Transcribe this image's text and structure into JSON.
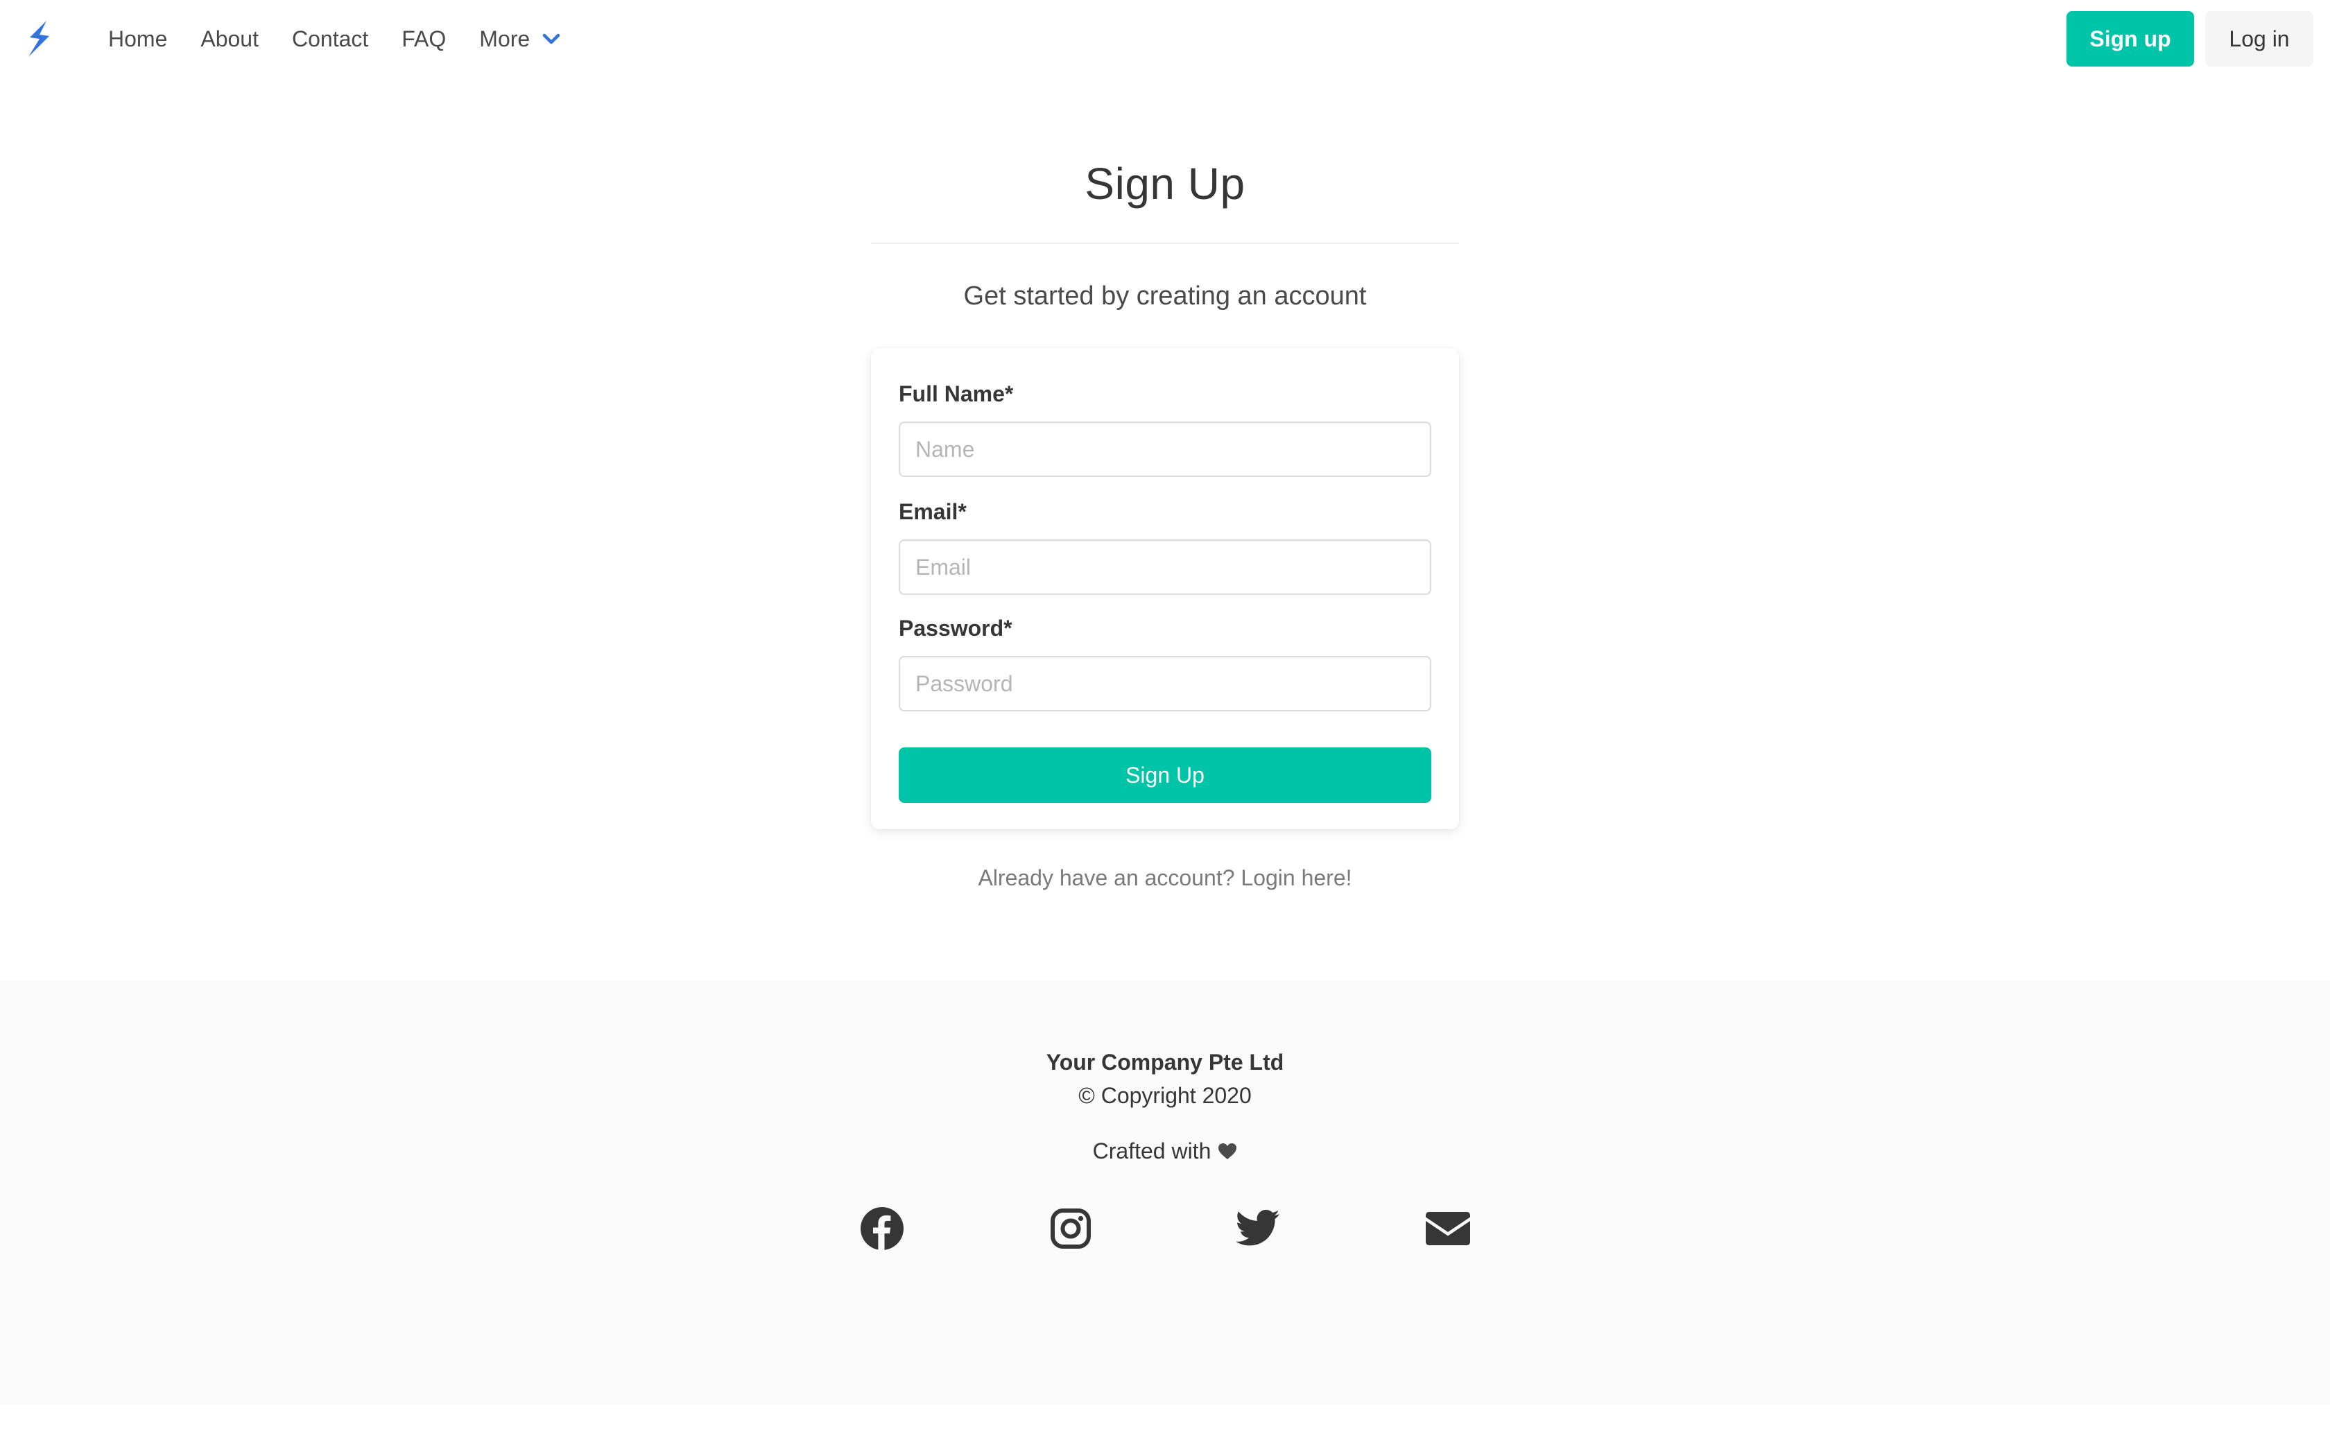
{
  "navbar": {
    "brand_icon": "lightning-bolt-icon",
    "links": [
      "Home",
      "About",
      "Contact",
      "FAQ"
    ],
    "more_label": "More",
    "signup_label": "Sign up",
    "login_label": "Log in"
  },
  "main": {
    "title": "Sign Up",
    "subtitle": "Get started by creating an account",
    "form": {
      "name_label": "Full Name*",
      "name_placeholder": "Name",
      "email_label": "Email*",
      "email_placeholder": "Email",
      "password_label": "Password*",
      "password_placeholder": "Password",
      "submit_label": "Sign Up"
    },
    "login_hint": "Already have an account? Login here!"
  },
  "footer": {
    "company": "Your Company Pte Ltd",
    "copyright": "© Copyright 2020",
    "crafted": "Crafted with",
    "social": [
      "facebook-icon",
      "instagram-icon",
      "twitter-icon",
      "envelope-icon"
    ]
  },
  "colors": {
    "primary": "#00c4a7",
    "link_blue": "#3273dc",
    "text": "#363636",
    "footer_bg": "#fafafa"
  }
}
